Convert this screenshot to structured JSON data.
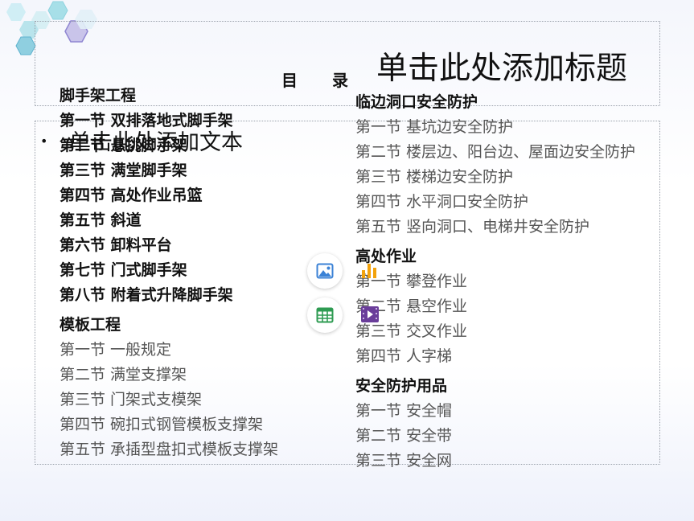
{
  "title_placeholder": "单击此处添加标题",
  "body_placeholder": "单击此处添加文本",
  "bullet": "•",
  "toc_heading": "目　　录",
  "left_column": [
    {
      "title": "脚手架工程",
      "bold_items": true,
      "items": [
        "第一节  双排落地式脚手架",
        "第二节  悬挑脚手架",
        "第三节  满堂脚手架",
        "第四节  高处作业吊篮",
        "第五节  斜道",
        "第六节  卸料平台",
        "第七节  门式脚手架",
        "第八节  附着式升降脚手架"
      ]
    },
    {
      "title": "模板工程",
      "bold_items": false,
      "items": [
        "第一节  一般规定",
        "第二节  满堂支撑架",
        "第三节  门架式支模架",
        "第四节  碗扣式钢管模板支撑架",
        "第五节  承插型盘扣式模板支撑架"
      ]
    }
  ],
  "right_column": [
    {
      "title": "临边洞口安全防护",
      "items": [
        "第一节  基坑边安全防护",
        "第二节  楼层边、阳台边、屋面边安全防护",
        "第三节  楼梯边安全防护",
        "第四节  水平洞口安全防护",
        "第五节  竖向洞口、电梯井安全防护"
      ]
    },
    {
      "title": "高处作业",
      "items": [
        "第一节  攀登作业",
        "第二节  悬空作业",
        "第三节  交叉作业",
        "第四节  人字梯"
      ]
    },
    {
      "title": "安全防护用品",
      "items": [
        "第一节  安全帽",
        "第二节  安全带",
        "第三节  安全网"
      ]
    }
  ],
  "icons": {
    "insert_image": "picture-icon",
    "insert_table": "table-icon",
    "insert_chart": "bar-chart-icon",
    "insert_video": "video-icon"
  },
  "colors": {
    "image_icon": "#3b82d6",
    "table_icon": "#2e9b52",
    "chart_icon": "#f2a20c",
    "video_icon": "#6a3d9a"
  }
}
